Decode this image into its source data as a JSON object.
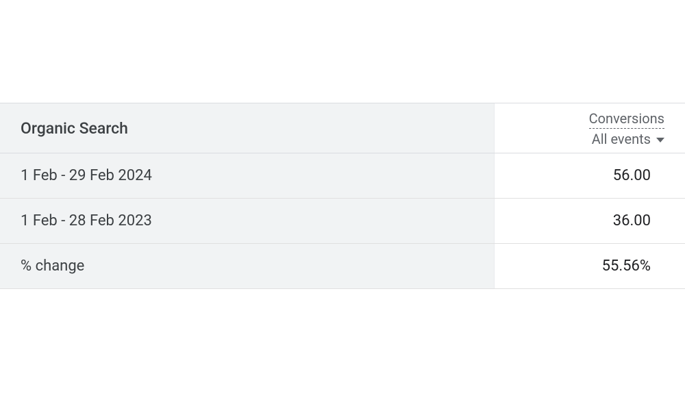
{
  "table": {
    "dimension_header": "Organic Search",
    "metric_header": "Conversions",
    "metric_dropdown_label": "All events",
    "rows": [
      {
        "label": "1 Feb - 29 Feb 2024",
        "value": "56.00"
      },
      {
        "label": "1 Feb - 28 Feb 2023",
        "value": "36.00"
      },
      {
        "label": "% change",
        "value": "55.56%"
      }
    ]
  }
}
